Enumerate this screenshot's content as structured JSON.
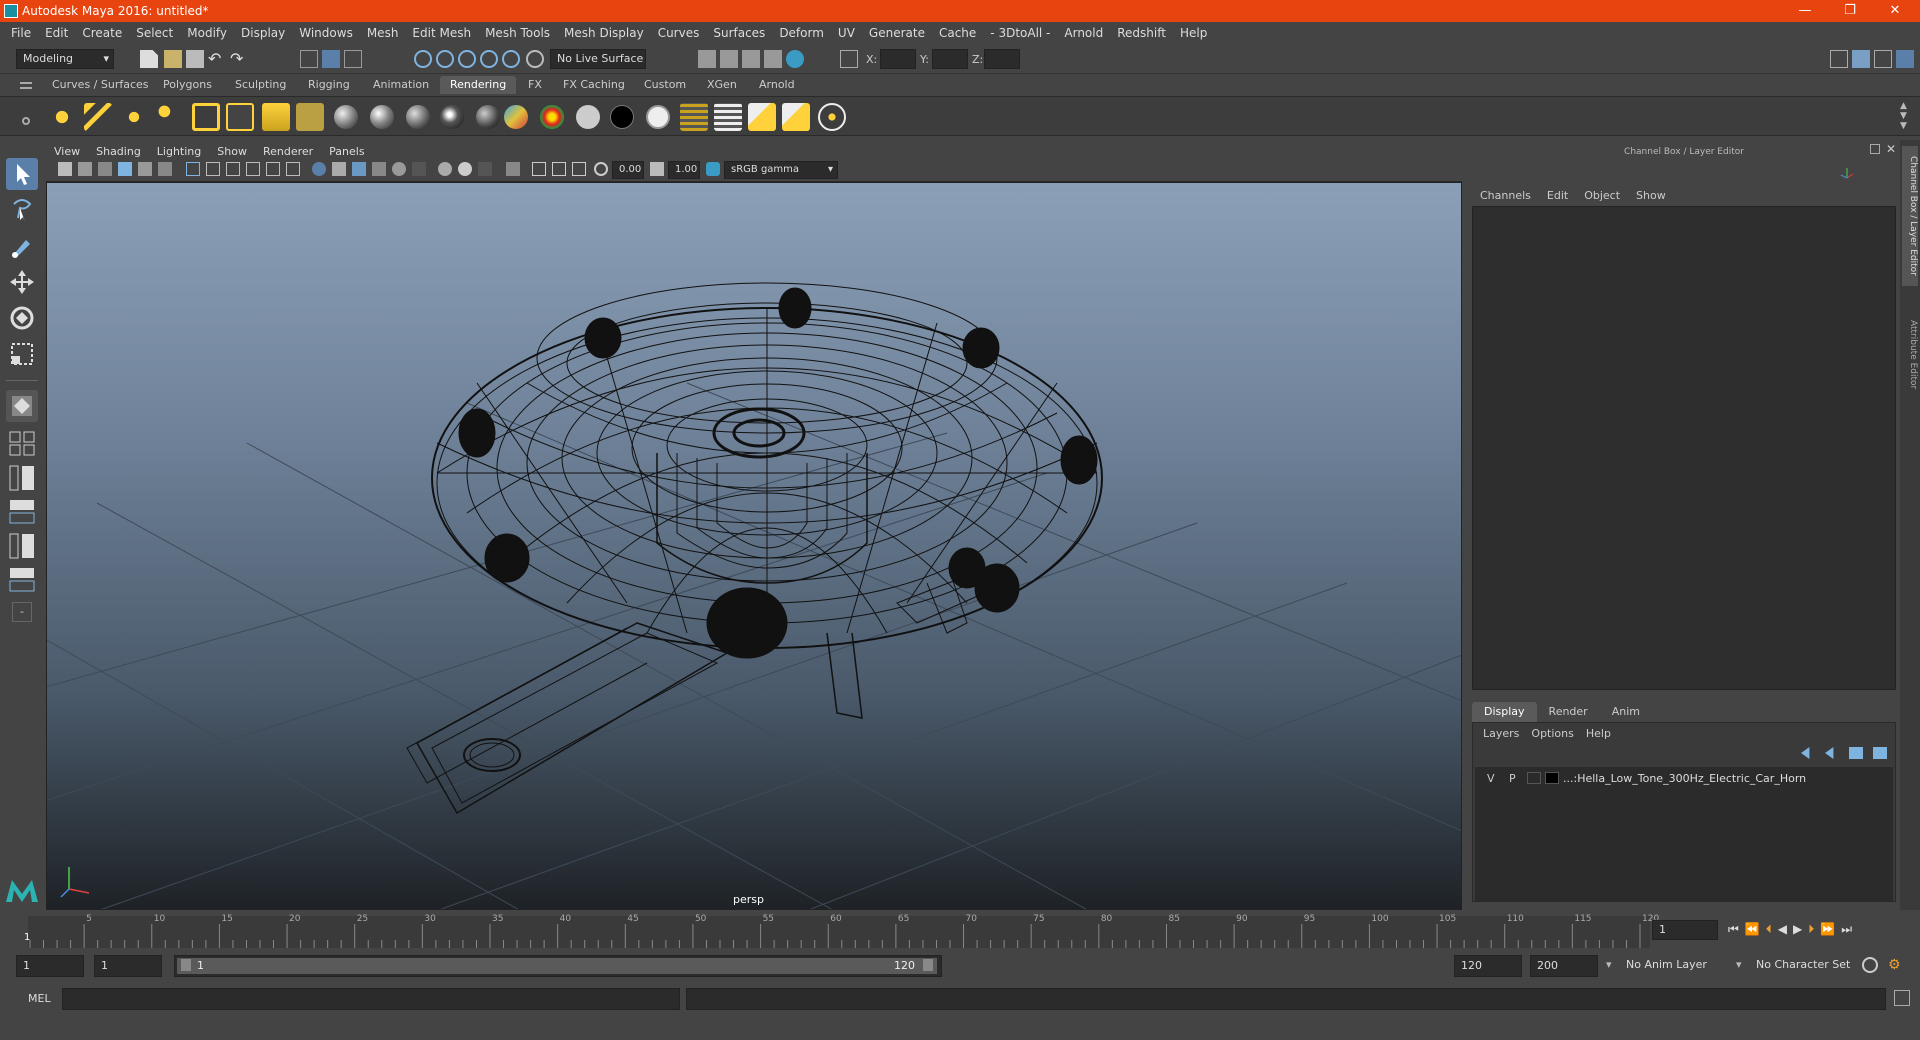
{
  "app": {
    "title": "Autodesk Maya 2016: untitled*"
  },
  "window_controls": {
    "minimize": "—",
    "restore": "❐",
    "close": "✕"
  },
  "menu": [
    "File",
    "Edit",
    "Create",
    "Select",
    "Modify",
    "Display",
    "Windows",
    "Mesh",
    "Edit Mesh",
    "Mesh Tools",
    "Mesh Display",
    "Curves",
    "Surfaces",
    "Deform",
    "UV",
    "Generate",
    "Cache",
    "- 3DtoAll -",
    "Arnold",
    "Redshift",
    "Help"
  ],
  "status": {
    "mode": "Modeling",
    "live_surface": "No Live Surface",
    "x_label": "X:",
    "y_label": "Y:",
    "z_label": "Z:"
  },
  "shelf_tabs": [
    "Curves / Surfaces",
    "Polygons",
    "Sculpting",
    "Rigging",
    "Animation",
    "Rendering",
    "FX",
    "FX Caching",
    "Custom",
    "XGen",
    "Arnold"
  ],
  "shelf_active": "Rendering",
  "viewport": {
    "menu": [
      "View",
      "Shading",
      "Lighting",
      "Show",
      "Renderer",
      "Panels"
    ],
    "exposure": "0.00",
    "gamma": "1.00",
    "color_space": "sRGB gamma",
    "camera_label": "persp"
  },
  "channel_box": {
    "header": "Channel Box / Layer Editor",
    "menu": [
      "Channels",
      "Edit",
      "Object",
      "Show"
    ],
    "layer_tabs": [
      "Display",
      "Render",
      "Anim"
    ],
    "layer_menu": [
      "Layers",
      "Options",
      "Help"
    ],
    "layer": {
      "v": "V",
      "p": "P",
      "name": "...:Hella_Low_Tone_300Hz_Electric_Car_Horn"
    }
  },
  "side_tabs": {
    "channel": "Channel Box / Layer Editor",
    "attr": "Attribute Editor"
  },
  "timeline": {
    "ticks": [
      "5",
      "10",
      "15",
      "20",
      "25",
      "30",
      "35",
      "40",
      "45",
      "50",
      "55",
      "60",
      "65",
      "70",
      "75",
      "80",
      "85",
      "90",
      "95",
      "100",
      "105",
      "110",
      "115",
      "120"
    ],
    "start_label": "1",
    "current_frame": "1"
  },
  "range": {
    "start": "1",
    "anim_start": "1",
    "slider_start": "1",
    "slider_end": "120",
    "end": "120",
    "anim_end": "200",
    "anim_layer": "No Anim Layer",
    "char_set": "No Character Set"
  },
  "cmd": {
    "label": "MEL"
  }
}
